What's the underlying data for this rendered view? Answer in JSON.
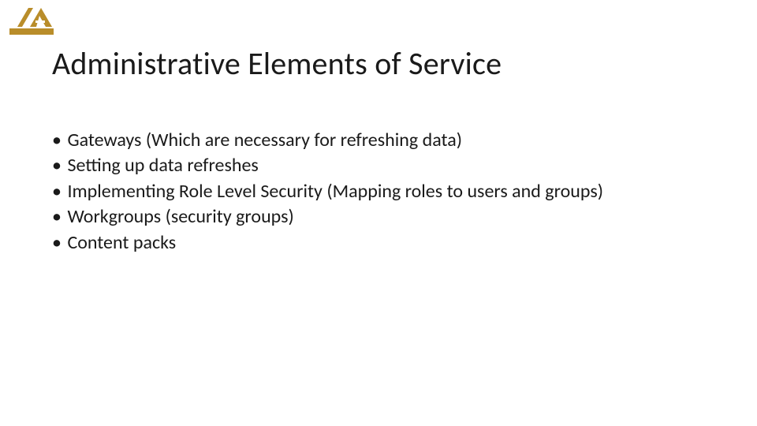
{
  "title": "Administrative Elements of Service",
  "bullets": [
    "Gateways (Which are necessary for refreshing data)",
    "Setting up data refreshes",
    "Implementing Role Level Security (Mapping roles to users and groups)",
    "Workgroups (security groups)",
    "Content packs"
  ]
}
